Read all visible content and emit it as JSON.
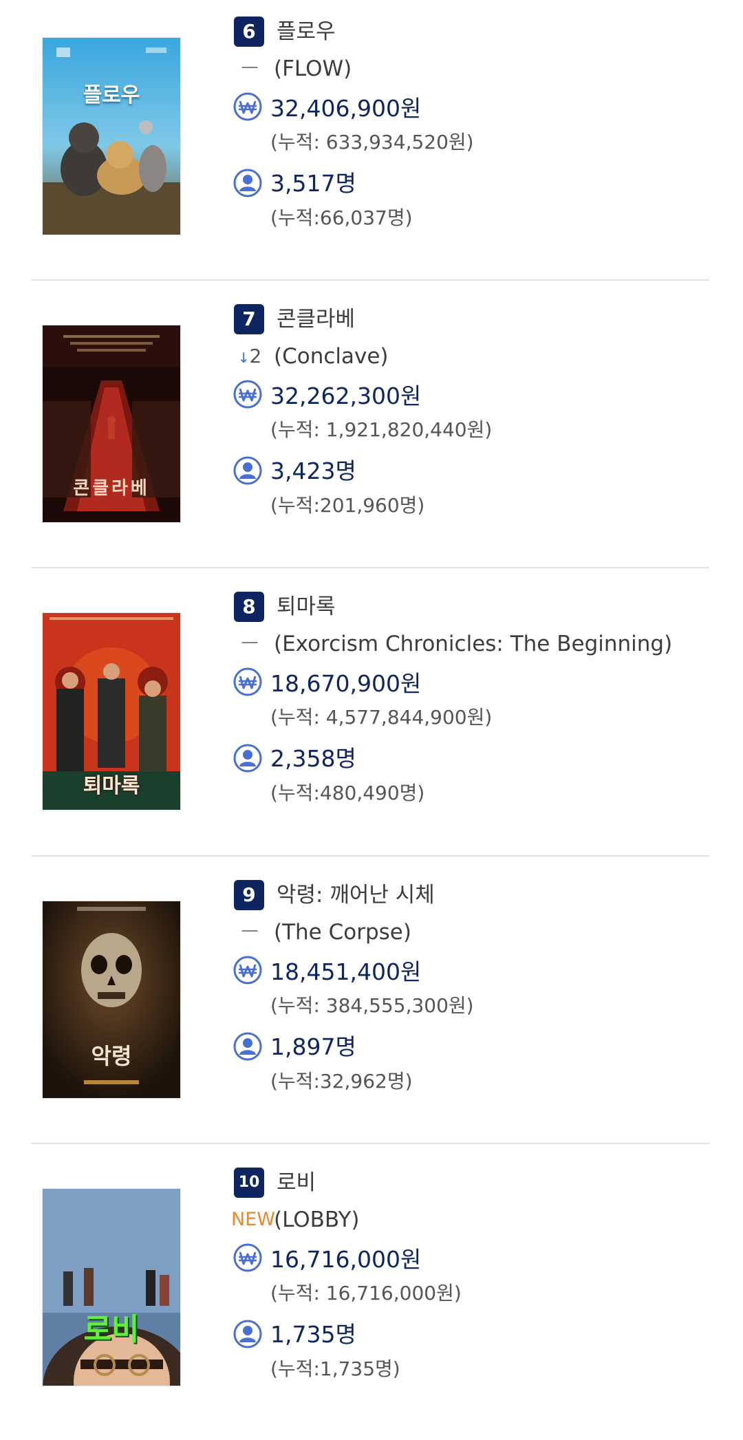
{
  "movies": [
    {
      "rank": "6",
      "title_kr": "플로우",
      "change": "ㅡ",
      "title_en": "(FLOW)",
      "sales": "32,406,900원",
      "sales_total": "(누적: 633,934,520원)",
      "audience": "3,517명",
      "audience_total": "(누적:66,037명)",
      "poster_title": "플로우"
    },
    {
      "rank": "7",
      "title_kr": "콘클라베",
      "change_arrow": "↓",
      "change": "2",
      "title_en": "(Conclave)",
      "sales": "32,262,300원",
      "sales_total": "(누적: 1,921,820,440원)",
      "audience": "3,423명",
      "audience_total": "(누적:201,960명)",
      "poster_title": "콘클라베"
    },
    {
      "rank": "8",
      "title_kr": "퇴마록",
      "change": "ㅡ",
      "title_en": "(Exorcism Chronicles: The Beginning)",
      "sales": "18,670,900원",
      "sales_total": "(누적: 4,577,844,900원)",
      "audience": "2,358명",
      "audience_total": "(누적:480,490명)",
      "poster_title": "퇴마록"
    },
    {
      "rank": "9",
      "title_kr": "악령: 깨어난 시체",
      "change": "ㅡ",
      "title_en": "(The Corpse)",
      "sales": "18,451,400원",
      "sales_total": "(누적: 384,555,300원)",
      "audience": "1,897명",
      "audience_total": "(누적:32,962명)",
      "poster_title": "악령"
    },
    {
      "rank": "10",
      "title_kr": "로비",
      "change": "NEW",
      "title_en": "(LOBBY)",
      "sales": "16,716,000원",
      "sales_total": "(누적: 16,716,000원)",
      "audience": "1,735명",
      "audience_total": "(누적:1,735명)",
      "poster_title": "로비"
    }
  ],
  "colors": {
    "badge": "#0f2560",
    "value_text": "#0f2560",
    "icon_blue": "#4a6fd3",
    "new_orange": "#e9892a",
    "divider": "#e2e2e2"
  },
  "icons": {
    "sales": "won-icon",
    "audience": "person-icon"
  }
}
